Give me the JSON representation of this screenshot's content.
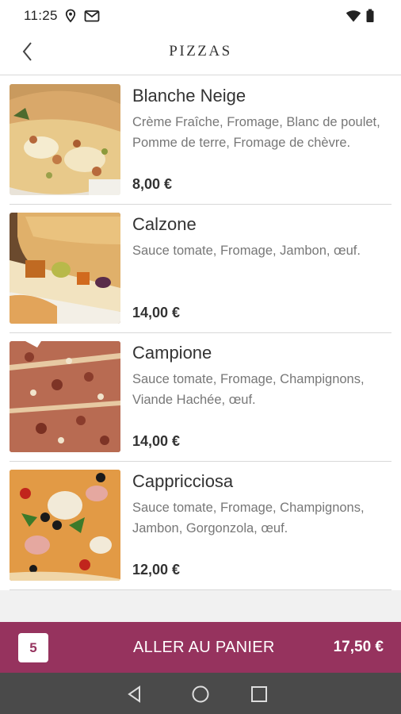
{
  "status_bar": {
    "time": "11:25",
    "icons": [
      "location-icon",
      "gmail-icon",
      "wifi-icon",
      "battery-icon"
    ]
  },
  "header": {
    "title": "PIZZAS",
    "back_icon": "chevron-left-icon"
  },
  "items": [
    {
      "name": "Blanche Neige",
      "description": "Crème Fraîche, Fromage, Blanc de poulet, Pomme de terre, Fromage de chèvre.",
      "price": "8,00 €"
    },
    {
      "name": "Calzone",
      "description": "Sauce tomate, Fromage, Jambon, œuf.",
      "price": "14,00 €"
    },
    {
      "name": "Campione",
      "description": "Sauce tomate, Fromage, Champignons, Viande Hachée, œuf.",
      "price": "14,00 €"
    },
    {
      "name": "Cappricciosa",
      "description": "Sauce tomate, Fromage, Champignons, Jambon, Gorgonzola, œuf.",
      "price": "12,00 €"
    }
  ],
  "cart": {
    "count": "5",
    "label": "ALLER AU PANIER",
    "total": "17,50 €"
  },
  "nav": {
    "icons": [
      "back-triangle-icon",
      "home-circle-icon",
      "recents-square-icon"
    ]
  },
  "colors": {
    "accent": "#96335e",
    "nav_bar": "#4a4a4a"
  }
}
